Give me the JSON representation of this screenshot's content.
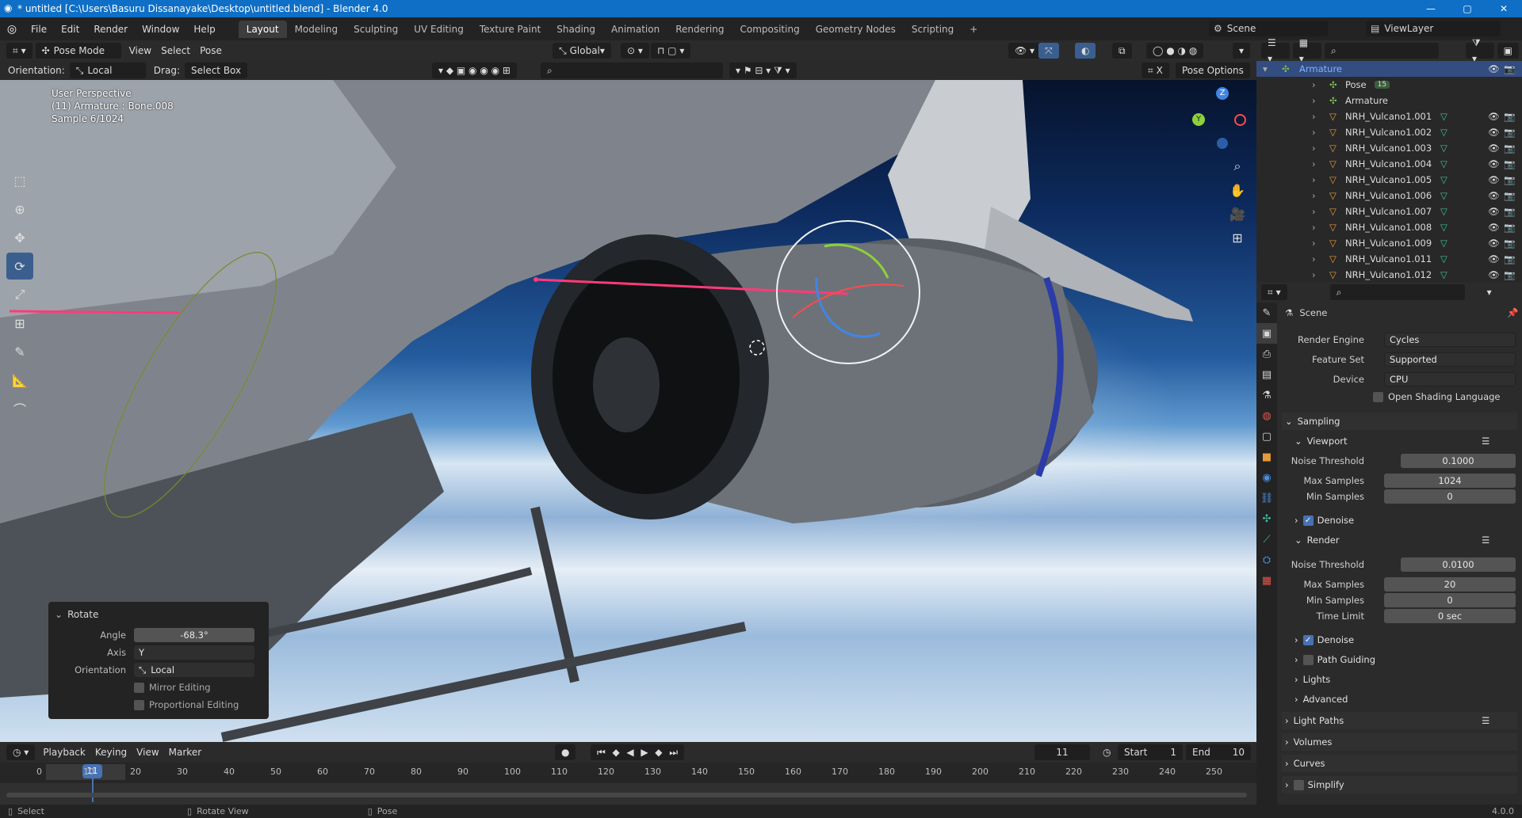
{
  "window": {
    "title": "* untitled [C:\\Users\\Basuru Dissanayake\\Desktop\\untitled.blend] - Blender 4.0",
    "min": "—",
    "max": "▢",
    "close": "✕"
  },
  "menu": {
    "items": [
      "File",
      "Edit",
      "Render",
      "Window",
      "Help"
    ],
    "workspaces": [
      "Layout",
      "Modeling",
      "Sculpting",
      "UV Editing",
      "Texture Paint",
      "Shading",
      "Animation",
      "Rendering",
      "Compositing",
      "Geometry Nodes",
      "Scripting"
    ],
    "add_tab": "+",
    "scene": "Scene",
    "view_layer": "ViewLayer"
  },
  "viewport_header": {
    "mode": "Pose Mode",
    "menus": [
      "View",
      "Select",
      "Pose"
    ],
    "transform": "Global",
    "orientation_label": "Orientation:",
    "orientation": "Local",
    "drag_label": "Drag:",
    "drag": "Select Box",
    "pose_options": "Pose Options"
  },
  "viewport": {
    "perspective": "User Perspective",
    "object": "(11) Armature : Bone.008",
    "sample": "Sample 6/1024",
    "gizmo": {
      "z": "Z",
      "y": "Y"
    }
  },
  "rotate_panel": {
    "title": "Rotate",
    "angle_label": "Angle",
    "angle": "-68.3°",
    "axis_label": "Axis",
    "axis": "Y",
    "orientation_label": "Orientation",
    "orientation": "Local",
    "mirror": "Mirror Editing",
    "proportional": "Proportional Editing"
  },
  "outliner": {
    "root": "Armature",
    "items": [
      "Pose",
      "Armature",
      "NRH_Vulcano1.001",
      "NRH_Vulcano1.002",
      "NRH_Vulcano1.003",
      "NRH_Vulcano1.004",
      "NRH_Vulcano1.005",
      "NRH_Vulcano1.006",
      "NRH_Vulcano1.007",
      "NRH_Vulcano1.008",
      "NRH_Vulcano1.009",
      "NRH_Vulcano1.011",
      "NRH_Vulcano1.012"
    ],
    "pose_badge": "15"
  },
  "properties": {
    "scene": "Scene",
    "render_engine_label": "Render Engine",
    "render_engine": "Cycles",
    "feature_set_label": "Feature Set",
    "feature_set": "Supported",
    "device_label": "Device",
    "device": "CPU",
    "osl": "Open Shading Language",
    "sampling": "Sampling",
    "viewport": "Viewport",
    "noise_threshold_label": "Noise Threshold",
    "vp_noise": "0.1000",
    "max_samples_label": "Max Samples",
    "vp_max": "1024",
    "min_samples_label": "Min Samples",
    "vp_min": "0",
    "denoise": "Denoise",
    "render": "Render",
    "r_noise": "0.0100",
    "r_max": "20",
    "r_min": "0",
    "time_limit_label": "Time Limit",
    "time_limit": "0 sec",
    "path_guiding": "Path Guiding",
    "lights": "Lights",
    "advanced": "Advanced",
    "light_paths": "Light Paths",
    "volumes": "Volumes",
    "curves": "Curves",
    "simplify": "Simplify"
  },
  "timeline": {
    "menus": [
      "Playback",
      "Keying",
      "View",
      "Marker"
    ],
    "current": "11",
    "start_label": "Start",
    "start": "1",
    "end_label": "End",
    "end": "10",
    "ticks": [
      "0",
      "10",
      "20",
      "30",
      "40",
      "50",
      "60",
      "70",
      "80",
      "90",
      "100",
      "110",
      "120",
      "130",
      "140",
      "150",
      "160",
      "170",
      "180",
      "190",
      "200",
      "210",
      "220",
      "230",
      "240",
      "250"
    ]
  },
  "status": {
    "select": "Select",
    "rotate": "Rotate View",
    "pose": "Pose",
    "version": "4.0.0"
  }
}
